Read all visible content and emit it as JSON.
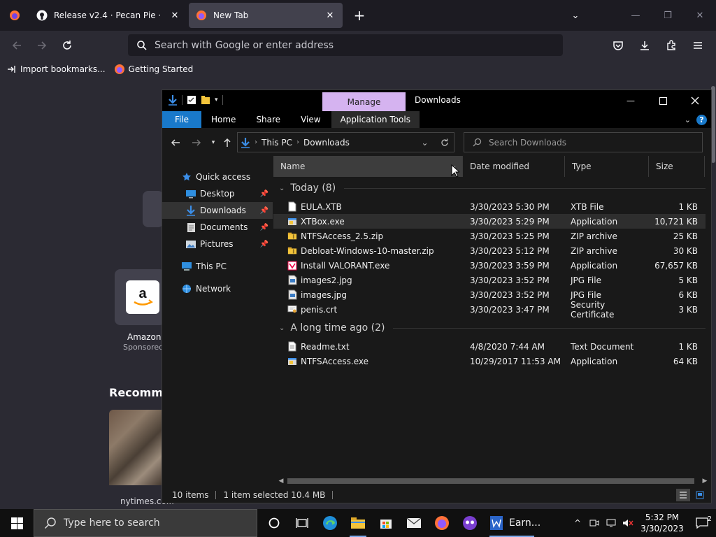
{
  "firefox": {
    "tabs": [
      {
        "label": "Release v2.4 · Pecan Pie · xemu",
        "icon": "github-icon"
      },
      {
        "label": "New Tab",
        "icon": "firefox-icon"
      }
    ],
    "url_placeholder": "Search with Google or enter address",
    "bookmarks": [
      {
        "label": "Import bookmarks..."
      },
      {
        "label": "Getting Started"
      }
    ],
    "newtab": {
      "shortcut_label": "Amazon",
      "shortcut_sub": "Sponsored",
      "section_title": "Recomme",
      "story_source": "nytimes.co..."
    }
  },
  "explorer": {
    "title": "Downloads",
    "context_tab": "Manage",
    "ribbon_tabs": [
      "File",
      "Home",
      "Share",
      "View",
      "Application Tools"
    ],
    "breadcrumb": [
      "This PC",
      "Downloads"
    ],
    "search_placeholder": "Search Downloads",
    "nav": [
      {
        "label": "Quick access",
        "icon": "star-icon"
      },
      {
        "label": "Desktop",
        "icon": "desktop-icon",
        "pinned": true
      },
      {
        "label": "Downloads",
        "icon": "download-icon",
        "pinned": true,
        "selected": true
      },
      {
        "label": "Documents",
        "icon": "documents-icon",
        "pinned": true
      },
      {
        "label": "Pictures",
        "icon": "pictures-icon",
        "pinned": true
      },
      {
        "label": "This PC",
        "icon": "computer-icon"
      },
      {
        "label": "Network",
        "icon": "network-icon"
      }
    ],
    "columns": [
      "Name",
      "Date modified",
      "Type",
      "Size"
    ],
    "groups": [
      {
        "label": "Today (8)",
        "files": [
          {
            "name": "EULA.XTB",
            "date": "3/30/2023 5:30 PM",
            "type": "XTB File",
            "size": "1 KB",
            "icon": "file-icon"
          },
          {
            "name": "XTBox.exe",
            "date": "3/30/2023 5:29 PM",
            "type": "Application",
            "size": "10,721 KB",
            "icon": "exe-icon",
            "selected": true
          },
          {
            "name": "NTFSAccess_2.5.zip",
            "date": "3/30/2023 5:25 PM",
            "type": "ZIP archive",
            "size": "25 KB",
            "icon": "zip-icon"
          },
          {
            "name": "Debloat-Windows-10-master.zip",
            "date": "3/30/2023 5:12 PM",
            "type": "ZIP archive",
            "size": "30 KB",
            "icon": "zip-icon"
          },
          {
            "name": "Install VALORANT.exe",
            "date": "3/30/2023 3:59 PM",
            "type": "Application",
            "size": "67,657 KB",
            "icon": "valorant-icon"
          },
          {
            "name": "images2.jpg",
            "date": "3/30/2023 3:52 PM",
            "type": "JPG File",
            "size": "5 KB",
            "icon": "image-icon"
          },
          {
            "name": "images.jpg",
            "date": "3/30/2023 3:52 PM",
            "type": "JPG File",
            "size": "6 KB",
            "icon": "image-icon"
          },
          {
            "name": "penis.crt",
            "date": "3/30/2023 3:47 PM",
            "type": "Security Certificate",
            "size": "3 KB",
            "icon": "certificate-icon"
          }
        ]
      },
      {
        "label": "A long time ago (2)",
        "files": [
          {
            "name": "Readme.txt",
            "date": "4/8/2020 7:44 AM",
            "type": "Text Document",
            "size": "1 KB",
            "icon": "text-file-icon"
          },
          {
            "name": "NTFSAccess.exe",
            "date": "10/29/2017 11:53 AM",
            "type": "Application",
            "size": "64 KB",
            "icon": "exe-icon"
          }
        ]
      }
    ],
    "status": {
      "items": "10 items",
      "selected": "1 item selected  10.4 MB"
    }
  },
  "taskbar": {
    "search_placeholder": "Type here to search",
    "app_label": "Earn...",
    "time": "5:32 PM",
    "date": "3/30/2023",
    "notifications": "2"
  },
  "colors": {
    "accent": "#1979ca",
    "manage_tab": "#d5b3f0",
    "folder": "#f3c43b"
  }
}
